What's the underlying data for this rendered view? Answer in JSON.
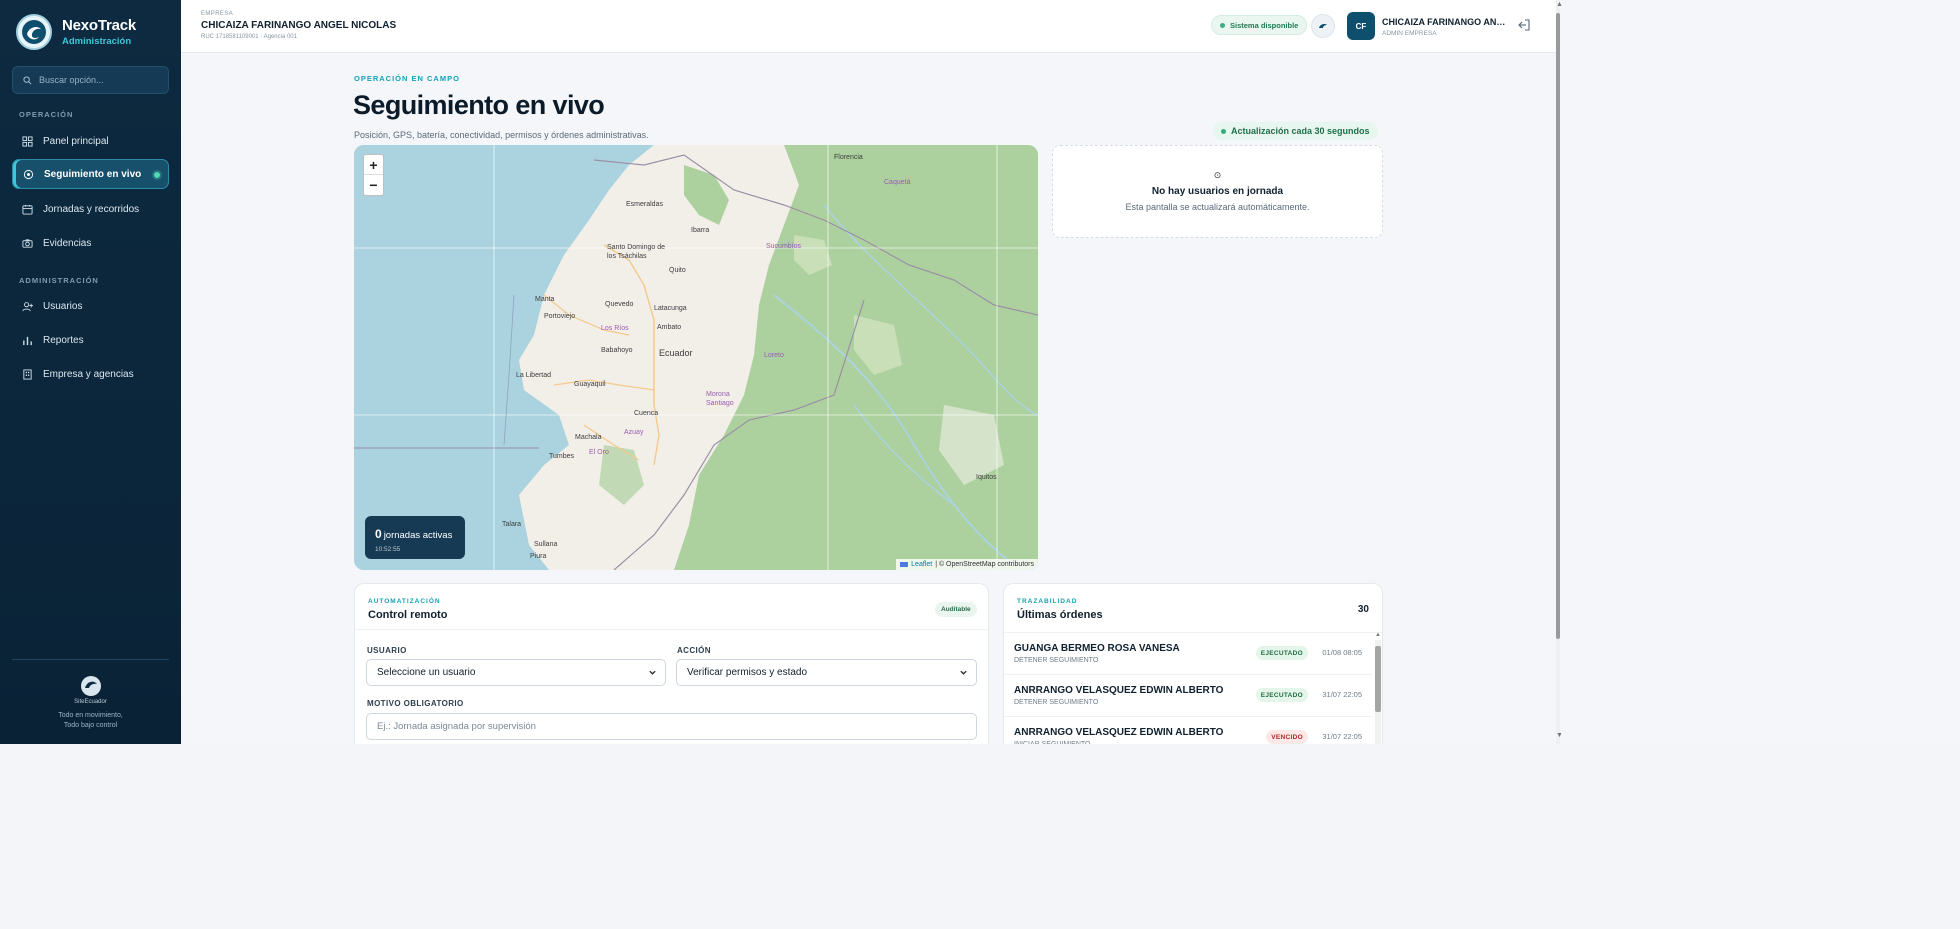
{
  "brand": {
    "name": "NexoTrack",
    "subtitle": "Administración"
  },
  "search": {
    "placeholder": "Buscar opción..."
  },
  "nav": {
    "section_operacion": "OPERACIÓN",
    "section_admin": "ADMINISTRACIÓN",
    "items": [
      {
        "label": "Panel principal"
      },
      {
        "label": "Seguimiento en vivo"
      },
      {
        "label": "Jornadas y recorridos"
      },
      {
        "label": "Evidencias"
      },
      {
        "label": "Usuarios"
      },
      {
        "label": "Reportes"
      },
      {
        "label": "Empresa y agencias"
      }
    ]
  },
  "sidebar_footer": {
    "logo_name": "SiteEcuador",
    "tagline_1": "Todo en movimiento,",
    "tagline_2": "Todo bajo control"
  },
  "topbar": {
    "company_label": "EMPRESA",
    "company_name": "CHICAIZA FARINANGO ANGEL NICOLAS",
    "company_ruc": "RUC 1718581109001 · Agencia 001",
    "status": "Sistema disponible",
    "user_initials": "CF",
    "user_name": "CHICAIZA FARINANGO ANGEL NICOLAS",
    "user_role": "ADMIN EMPRESA"
  },
  "page": {
    "eyebrow": "OPERACIÓN EN CAMPO",
    "title": "Seguimiento en vivo",
    "subtitle": "Posición, GPS, batería, conectividad, permisos y órdenes administrativas.",
    "update_badge": "Actualización cada 30 segundos"
  },
  "map": {
    "zoom_in": "+",
    "zoom_out": "−",
    "active_count": "0",
    "active_label": "jornadas activas",
    "time": "10:52:55",
    "attribution_leaflet": "Leaflet",
    "attribution_osm": "| © OpenStreetMap contributors",
    "places": [
      "Florencia",
      "Caquetá",
      "Esmeraldas",
      "Ibarra",
      "Sucumbíos",
      "Santo Domingo de los Tsáchilas",
      "Quito",
      "Manta",
      "Portoviejo",
      "Quevedo",
      "Latacunga",
      "Ambato",
      "Los Ríos",
      "Babahoyo",
      "Ecuador",
      "Loreto",
      "La Libertad",
      "Guayaquil",
      "Morona Santiago",
      "Cuenca",
      "Azuay",
      "Machala",
      "El Oro",
      "Tumbes",
      "Iquitos",
      "Talara",
      "Sullana",
      "Piura"
    ]
  },
  "empty_state": {
    "icon": "⊙",
    "title": "No hay usuarios en jornada",
    "message": "Esta pantalla se actualizará automáticamente."
  },
  "control": {
    "eyebrow": "AUTOMATIZACIÓN",
    "title": "Control remoto",
    "badge": "Auditable",
    "user_label": "USUARIO",
    "user_value": "Seleccione un usuario",
    "action_label": "ACCIÓN",
    "action_value": "Verificar permisos y estado",
    "reason_label": "MOTIVO OBLIGATORIO",
    "reason_placeholder": "Ej.: Jornada asignada por supervisión"
  },
  "orders": {
    "eyebrow": "TRAZABILIDAD",
    "title": "Últimas órdenes",
    "count": "30",
    "items": [
      {
        "name": "GUANGA BERMEO ROSA VANESA",
        "type": "DETENER SEGUIMIENTO",
        "status": "EJECUTADO",
        "date": "01/08 08:05"
      },
      {
        "name": "ANRRANGO VELASQUEZ EDWIN ALBERTO",
        "type": "DETENER SEGUIMIENTO",
        "status": "EJECUTADO",
        "date": "31/07 22:05"
      },
      {
        "name": "ANRRANGO VELASQUEZ EDWIN ALBERTO",
        "type": "INICIAR SEGUIMIENTO",
        "status": "VENCIDO",
        "date": "31/07 22:05"
      }
    ]
  },
  "colors": {
    "sidebar": "#0d2a40",
    "accent": "#14a1b6",
    "active_nav": "#17506b",
    "ok": "#1f6f41",
    "danger": "#b42323"
  }
}
